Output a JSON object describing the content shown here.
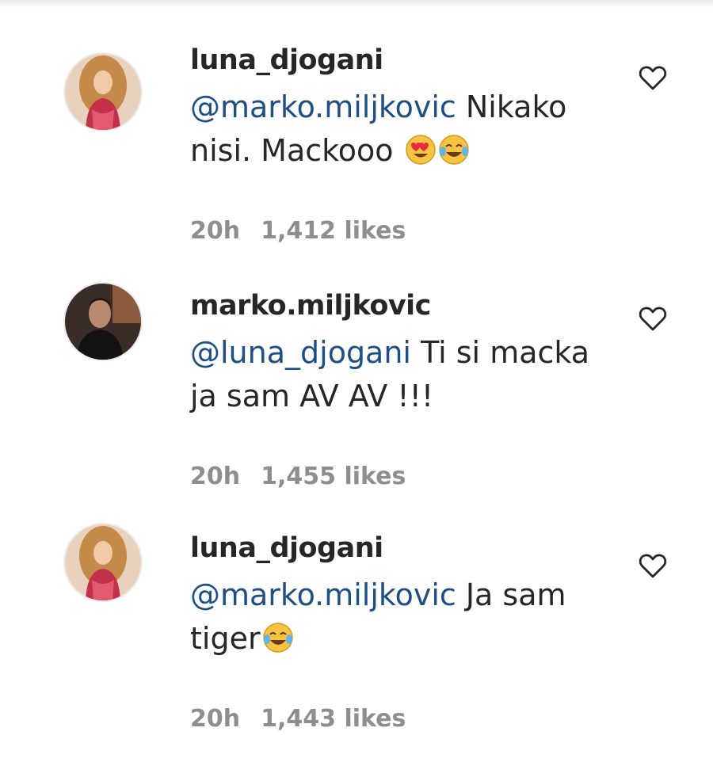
{
  "comments": [
    {
      "username": "luna_djogani",
      "mention": "@marko.miljkovic",
      "text": " Nikako nisi. Mackooo",
      "emojis": [
        "heart-eyes-emoji",
        "tears-of-joy-emoji"
      ],
      "time": "20h",
      "likes": "1,412 likes",
      "avatar": "avatar-luna"
    },
    {
      "username": "marko.miljkovic",
      "mention": "@luna_djogani",
      "text": " Ti si macka ja sam AV AV !!!",
      "emojis": [],
      "time": "20h",
      "likes": "1,455 likes",
      "avatar": "avatar-marko"
    },
    {
      "username": "luna_djogani",
      "mention": "@marko.miljkovic",
      "text": " Ja sam tiger",
      "emojis": [
        "tears-of-joy-emoji"
      ],
      "time": "20h",
      "likes": "1,443 likes",
      "avatar": "avatar-luna"
    }
  ],
  "icons": {
    "like": "heart-outline-icon"
  },
  "colors": {
    "mention": "#1e4e86",
    "meta": "#8e8e8e",
    "text": "#262626"
  }
}
